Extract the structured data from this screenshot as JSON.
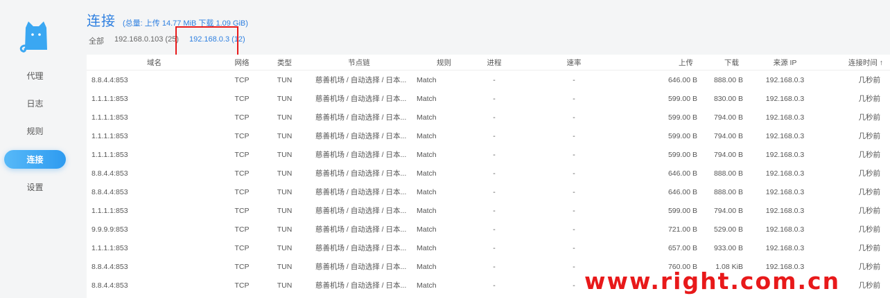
{
  "sidebar": {
    "items": [
      {
        "label": "代理",
        "active": false
      },
      {
        "label": "日志",
        "active": false
      },
      {
        "label": "规则",
        "active": false
      },
      {
        "label": "连接",
        "active": true
      },
      {
        "label": "设置",
        "active": false
      }
    ],
    "logo_icon": "cat-logo-icon"
  },
  "header": {
    "title": "连接",
    "totals": "(总量: 上传 14.77 MiB 下载 1.09 GiB)"
  },
  "filters": [
    {
      "label": "全部",
      "active": false
    },
    {
      "label": "192.168.0.103 (25)",
      "active": false
    },
    {
      "label": "192.168.0.3 (12)",
      "active": true
    }
  ],
  "table": {
    "columns": [
      "域名",
      "网络",
      "类型",
      "节点链",
      "规则",
      "进程",
      "速率",
      "上传",
      "下载",
      "来源 IP",
      "连接时间 ↑"
    ],
    "rows": [
      {
        "host": "8.8.4.4:853",
        "net": "TCP",
        "type": "TUN",
        "chain": "慈善机场 / 自动选择 / 日本...",
        "rule": "Match",
        "proc": "-",
        "speed": "-",
        "up": "646.00 B",
        "down": "888.00 B",
        "src": "192.168.0.3",
        "time": "几秒前"
      },
      {
        "host": "1.1.1.1:853",
        "net": "TCP",
        "type": "TUN",
        "chain": "慈善机场 / 自动选择 / 日本...",
        "rule": "Match",
        "proc": "-",
        "speed": "-",
        "up": "599.00 B",
        "down": "830.00 B",
        "src": "192.168.0.3",
        "time": "几秒前"
      },
      {
        "host": "1.1.1.1:853",
        "net": "TCP",
        "type": "TUN",
        "chain": "慈善机场 / 自动选择 / 日本...",
        "rule": "Match",
        "proc": "-",
        "speed": "-",
        "up": "599.00 B",
        "down": "794.00 B",
        "src": "192.168.0.3",
        "time": "几秒前"
      },
      {
        "host": "1.1.1.1:853",
        "net": "TCP",
        "type": "TUN",
        "chain": "慈善机场 / 自动选择 / 日本...",
        "rule": "Match",
        "proc": "-",
        "speed": "-",
        "up": "599.00 B",
        "down": "794.00 B",
        "src": "192.168.0.3",
        "time": "几秒前"
      },
      {
        "host": "1.1.1.1:853",
        "net": "TCP",
        "type": "TUN",
        "chain": "慈善机场 / 自动选择 / 日本...",
        "rule": "Match",
        "proc": "-",
        "speed": "-",
        "up": "599.00 B",
        "down": "794.00 B",
        "src": "192.168.0.3",
        "time": "几秒前"
      },
      {
        "host": "8.8.4.4:853",
        "net": "TCP",
        "type": "TUN",
        "chain": "慈善机场 / 自动选择 / 日本...",
        "rule": "Match",
        "proc": "-",
        "speed": "-",
        "up": "646.00 B",
        "down": "888.00 B",
        "src": "192.168.0.3",
        "time": "几秒前"
      },
      {
        "host": "8.8.4.4:853",
        "net": "TCP",
        "type": "TUN",
        "chain": "慈善机场 / 自动选择 / 日本...",
        "rule": "Match",
        "proc": "-",
        "speed": "-",
        "up": "646.00 B",
        "down": "888.00 B",
        "src": "192.168.0.3",
        "time": "几秒前"
      },
      {
        "host": "1.1.1.1:853",
        "net": "TCP",
        "type": "TUN",
        "chain": "慈善机场 / 自动选择 / 日本...",
        "rule": "Match",
        "proc": "-",
        "speed": "-",
        "up": "599.00 B",
        "down": "794.00 B",
        "src": "192.168.0.3",
        "time": "几秒前"
      },
      {
        "host": "9.9.9.9:853",
        "net": "TCP",
        "type": "TUN",
        "chain": "慈善机场 / 自动选择 / 日本...",
        "rule": "Match",
        "proc": "-",
        "speed": "-",
        "up": "721.00 B",
        "down": "529.00 B",
        "src": "192.168.0.3",
        "time": "几秒前"
      },
      {
        "host": "1.1.1.1:853",
        "net": "TCP",
        "type": "TUN",
        "chain": "慈善机场 / 自动选择 / 日本...",
        "rule": "Match",
        "proc": "-",
        "speed": "-",
        "up": "657.00 B",
        "down": "933.00 B",
        "src": "192.168.0.3",
        "time": "几秒前"
      },
      {
        "host": "8.8.4.4:853",
        "net": "TCP",
        "type": "TUN",
        "chain": "慈善机场 / 自动选择 / 日本...",
        "rule": "Match",
        "proc": "-",
        "speed": "-",
        "up": "760.00 B",
        "down": "1.08 KiB",
        "src": "192.168.0.3",
        "time": "几秒前"
      },
      {
        "host": "8.8.4.4:853",
        "net": "TCP",
        "type": "TUN",
        "chain": "慈善机场 / 自动选择 / 日本...",
        "rule": "Match",
        "proc": "-",
        "speed": "-",
        "up": "",
        "down": "",
        "src": "",
        "time": "几秒前"
      }
    ]
  },
  "watermark": "www.right.com.cn",
  "colors": {
    "accent": "#2d7fe0",
    "active_nav": "#2e9bf0",
    "highlight": "#e8191a",
    "logo": "#3aa7f2"
  }
}
